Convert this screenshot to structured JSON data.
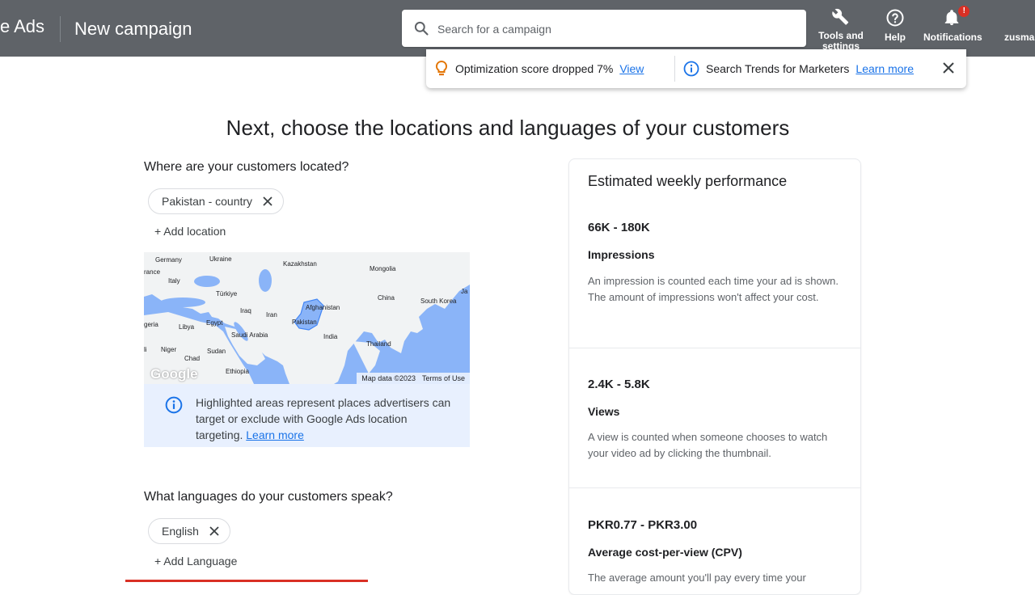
{
  "header": {
    "brand": "e Ads",
    "page_name": "New campaign",
    "search_placeholder": "Search for a campaign",
    "tools": [
      {
        "label": "Tools and settings",
        "icon": "wrench-icon"
      },
      {
        "label": "Help",
        "icon": "help-icon"
      },
      {
        "label": "Notifications",
        "icon": "bell-icon",
        "badge": "!"
      },
      {
        "label": "zusma",
        "icon": "account"
      }
    ]
  },
  "notifications": {
    "optimization": {
      "text": "Optimization score dropped 7%",
      "link": "View",
      "icon": "lightbulb-icon"
    },
    "trends": {
      "text": "Search Trends for Marketers",
      "link": "Learn more",
      "icon": "info-icon"
    }
  },
  "page": {
    "heading": "Next, choose the locations and languages of your customers"
  },
  "locations": {
    "question": "Where are your customers located?",
    "chips": [
      "Pakistan - country"
    ],
    "add_label": "+ Add location",
    "map": {
      "labels": [
        "Germany",
        "Ukraine",
        "Kazakhstan",
        "Mongolia",
        "rance",
        "Italy",
        "Türkiye",
        "Afghanistan",
        "China",
        "South Korea",
        "Ja",
        "Iraq",
        "Iran",
        "geria",
        "Libya",
        "Egypt",
        "Pakistan",
        "Saudi Arabia",
        "India",
        "Thailand",
        "li",
        "Niger",
        "Chad",
        "Sudan",
        "Ethiopia"
      ],
      "map_data": "Map data ©2023",
      "terms": "Terms of Use",
      "watermark": "Google"
    },
    "info": {
      "text": "Highlighted areas represent places advertisers can target or exclude with Google Ads location targeting.",
      "link": "Learn more"
    }
  },
  "languages": {
    "question": "What languages do your customers speak?",
    "chips": [
      "English"
    ],
    "add_label": "+ Add Language"
  },
  "performance": {
    "title": "Estimated weekly performance",
    "metrics": [
      {
        "value": "66K - 180K",
        "name": "Impressions",
        "description": "An impression is counted each time your ad is shown. The amount of impressions won't affect your cost."
      },
      {
        "value": "2.4K - 5.8K",
        "name": "Views",
        "description": "A view is counted when someone chooses to watch your video ad by clicking the thumbnail."
      },
      {
        "value": "PKR0.77 - PKR3.00",
        "name": "Average cost-per-view (CPV)",
        "description": "The average amount you'll pay every time your"
      }
    ]
  },
  "colors": {
    "header_bg": "#5f6368",
    "accent": "#1a73e8",
    "map_water": "#8ab4f8",
    "info_bg": "#e8f0fe"
  }
}
